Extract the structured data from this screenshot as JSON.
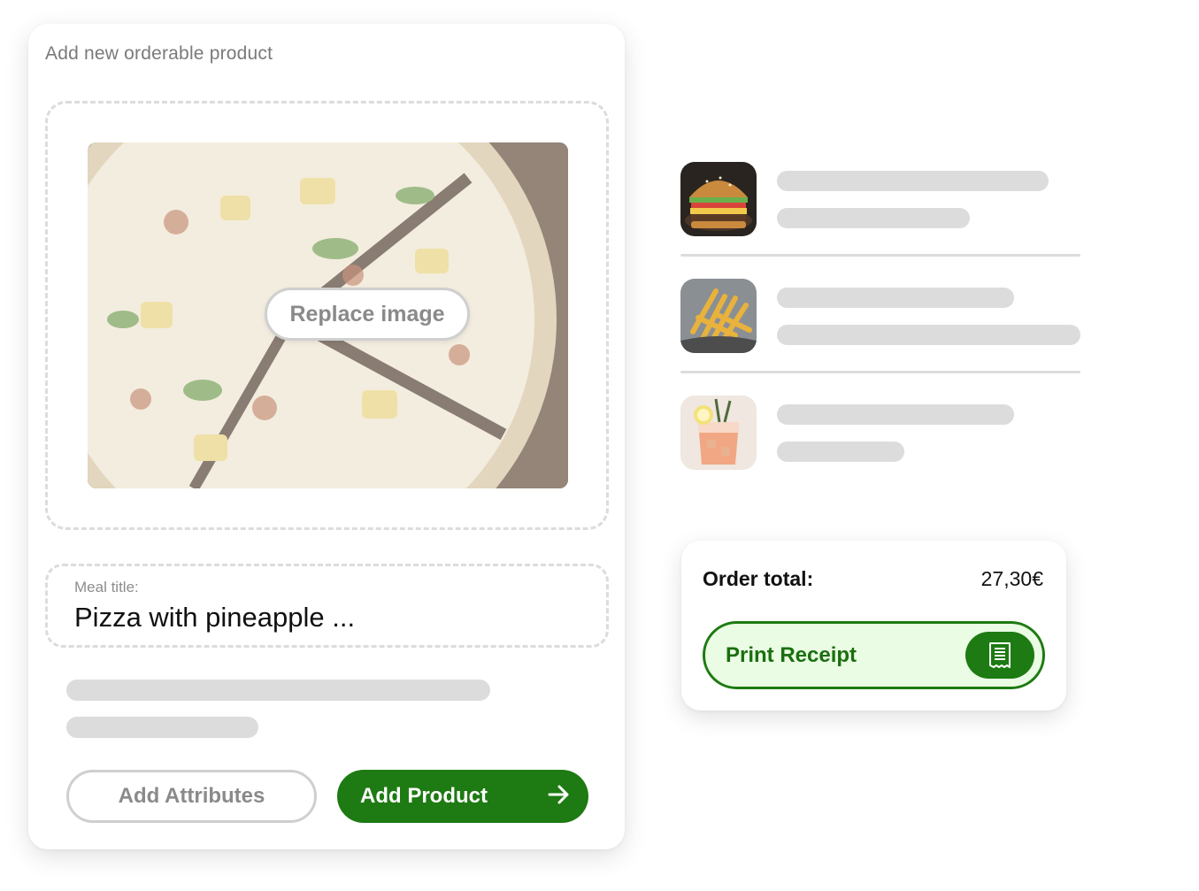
{
  "product_form": {
    "title": "Add new orderable product",
    "replace_image_label": "Replace image",
    "meal_title_label": "Meal title:",
    "meal_title_value": "Pizza with pineapple ...",
    "add_attributes_label": "Add Attributes",
    "add_product_label": "Add Product"
  },
  "order_items": [
    {
      "icon": "burger-image"
    },
    {
      "icon": "fries-image"
    },
    {
      "icon": "cocktail-image"
    }
  ],
  "order_summary": {
    "total_label": "Order total:",
    "total_value": "27,30€",
    "print_label": "Print Receipt"
  },
  "colors": {
    "accent": "#1e7a12",
    "accent_light": "#eafce3",
    "skeleton": "#dcdcdc",
    "muted_text": "#8a8a8a"
  },
  "icons": {
    "arrow": "arrow-right-icon",
    "receipt": "receipt-icon"
  }
}
